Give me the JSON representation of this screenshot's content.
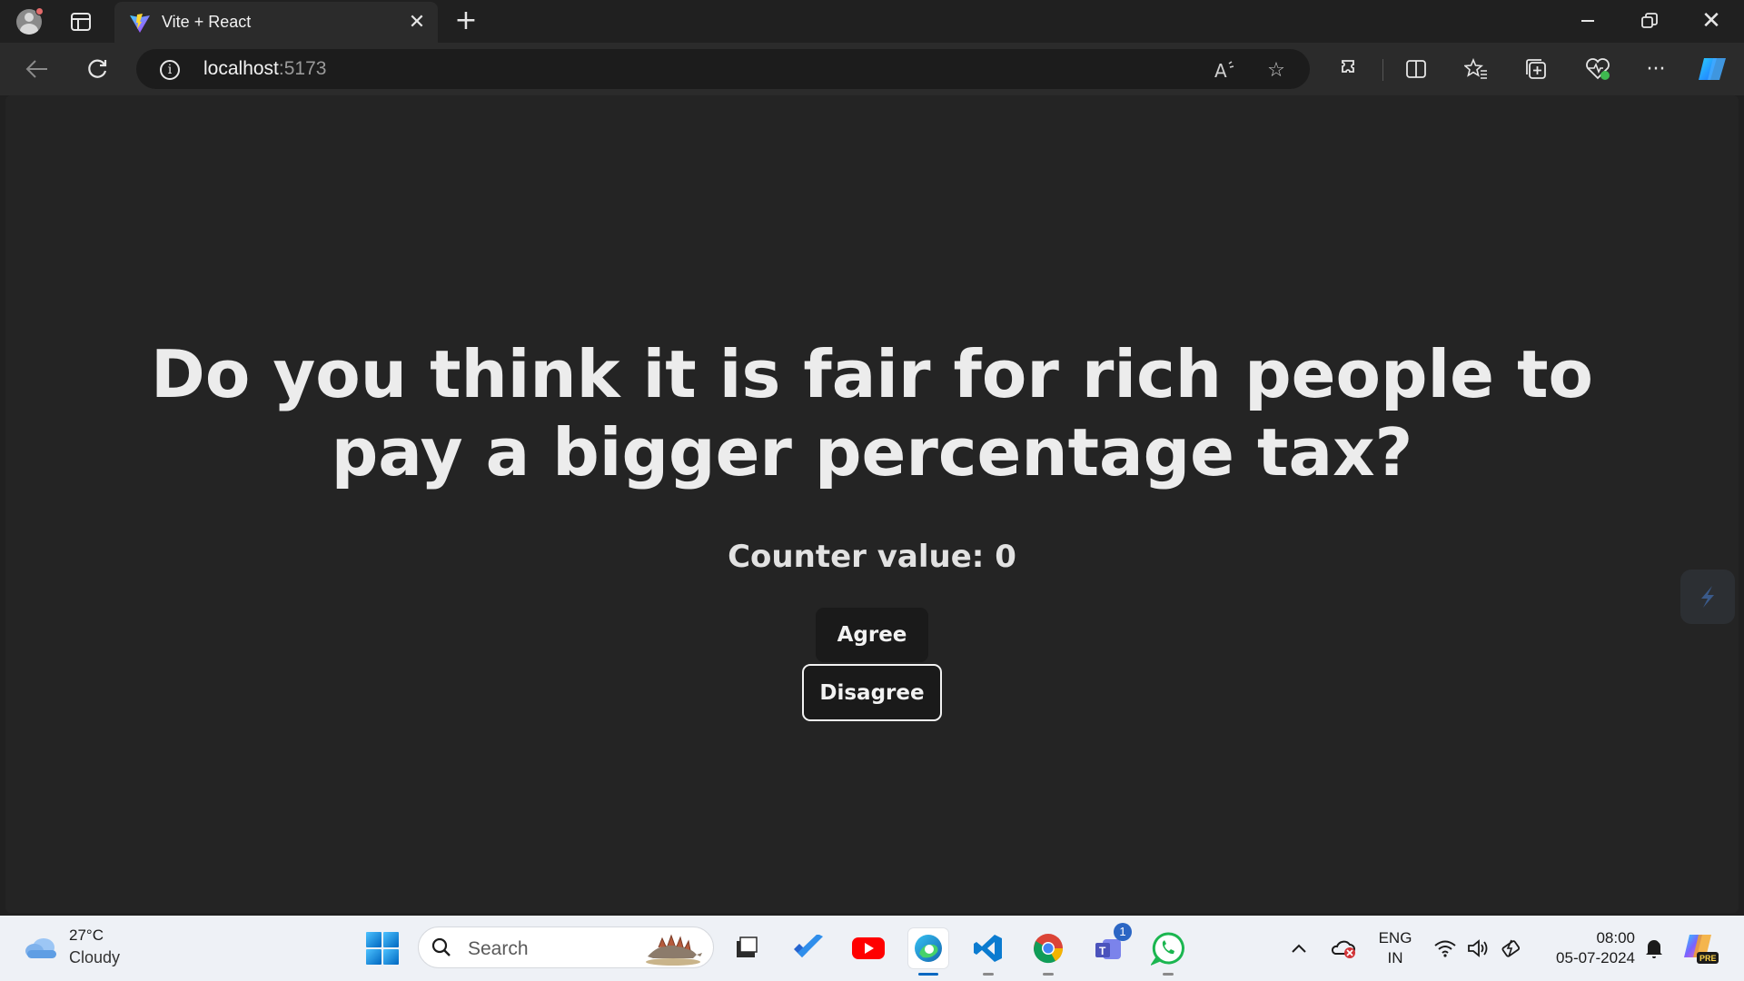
{
  "browser": {
    "tab_title": "Vite + React",
    "url_host": "localhost",
    "url_port": ":5173"
  },
  "page": {
    "question": "Do you think it is fair for rich people to pay a bigger percentage tax?",
    "counter_text": "Counter value: 0",
    "agree_label": "Agree",
    "disagree_label": "Disagree"
  },
  "taskbar": {
    "weather_temp": "27°C",
    "weather_desc": "Cloudy",
    "search_placeholder": "Search",
    "teams_badge": "1",
    "lang_primary": "ENG",
    "lang_secondary": "IN",
    "time": "08:00",
    "date": "05-07-2024",
    "copilot_badge": "PRE"
  },
  "colors": {
    "page_bg": "#242424",
    "browser_chrome": "#202020",
    "toolbar": "#2b2b2b",
    "button_bg": "#1a1a1a",
    "taskbar": "#eef1f6",
    "accent": "#0067c0"
  }
}
